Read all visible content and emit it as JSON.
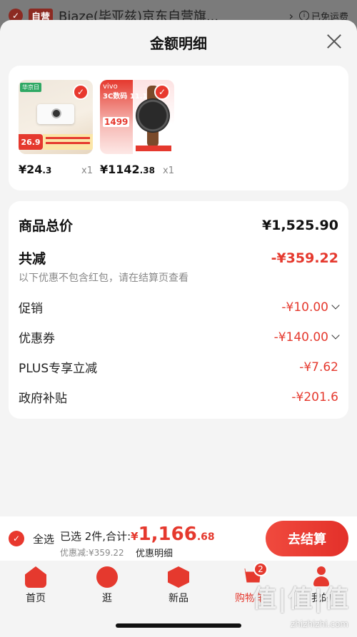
{
  "store": {
    "badge": "自营",
    "name": "Biaze(毕亚兹)京东自营旗...",
    "arrow": "›",
    "free_shipping": "已免运费",
    "info_icon": "i"
  },
  "sheet": {
    "title": "金额明细",
    "close_label": ""
  },
  "products": [
    {
      "price_int": "¥24",
      "price_dec": ".3",
      "qty": "x1",
      "tag": "华京日",
      "art_price": "26.9"
    },
    {
      "price_int": "¥1142",
      "price_dec": ".38",
      "qty": "x1",
      "brand": "vivo",
      "art_text": "3C数码 11.11",
      "art_price": "1499"
    }
  ],
  "details": {
    "total_label": "商品总价",
    "total_value": "¥1,525.90",
    "reduce_label": "共减",
    "reduce_value": "-¥359.22",
    "reduce_note": "以下优惠不包含红包，请在结算页查看",
    "items": [
      {
        "label": "促销",
        "value": "-¥10.00",
        "expandable": true
      },
      {
        "label": "优惠券",
        "value": "-¥140.00",
        "expandable": true
      },
      {
        "label": "PLUS专享立减",
        "value": "-¥7.62",
        "expandable": false
      },
      {
        "label": "政府补贴",
        "value": "-¥201.6",
        "expandable": false
      }
    ]
  },
  "checkout": {
    "select_all": "全选",
    "selected_text": "已选 2件,合计:",
    "currency": "¥",
    "amount_int": "1,166",
    "amount_dec": ".68",
    "discount_text": "优惠减:¥359.22",
    "detail_link": "优惠明细",
    "pay_button": "去结算"
  },
  "tabbar": {
    "items": [
      {
        "label": "首页",
        "icon": "home-icon",
        "active": false
      },
      {
        "label": "逛",
        "icon": "stroll-icon",
        "active": false
      },
      {
        "label": "新品",
        "icon": "new-icon",
        "active": false
      },
      {
        "label": "购物车",
        "icon": "cart-icon",
        "active": true,
        "badge": "2"
      },
      {
        "label": "我的",
        "icon": "me-icon",
        "active": false
      }
    ]
  },
  "watermark": {
    "text": "值|值|值",
    "url": "zhizhizhi.com"
  },
  "colors": {
    "accent": "#e5392e",
    "background": "#f4f4f4"
  }
}
